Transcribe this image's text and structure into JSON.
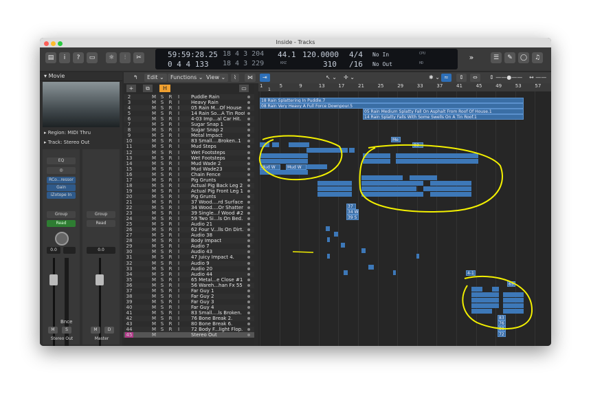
{
  "window": {
    "title": "Inside - Tracks"
  },
  "toolbar": {
    "lcd": {
      "time_top": "59:59:28.25",
      "time_bottom": "0 4 4 133",
      "bars_top": "18 4 3 204",
      "bars_bottom": "18 4 3 229",
      "tempo_label_top": "44.1",
      "tempo_label_bottom": "KHZ",
      "bpm_top": "120.0000",
      "bpm_bottom": "310",
      "sig_top": "4/4",
      "sig_bottom": "/16",
      "in_label": "No In",
      "out_label": "No Out",
      "cpu_label": "CPU",
      "hd_label": "HD"
    }
  },
  "inspector": {
    "header": "Movie",
    "region": "Region: MIDI Thru",
    "track": "Track: Stereo Out",
    "eq": "EQ",
    "plugins": [
      "RCo...ressor",
      "Gain",
      "iZotope In"
    ],
    "group1": "Group",
    "read1": "Read",
    "group2": "Group",
    "read2": "Read",
    "val1": "0.0",
    "val2": "0.0",
    "bnce": "Bnce",
    "m1": "M",
    "s1": "S",
    "m2": "M",
    "d2": "D",
    "strip1": "Stereo Out",
    "strip2": "Master"
  },
  "menubar": {
    "edit": "Edit",
    "functions": "Functions",
    "view": "View"
  },
  "ruler": [
    "1",
    "5",
    "9",
    "13",
    "17",
    "21",
    "25",
    "29",
    "33",
    "37",
    "41",
    "45",
    "49",
    "53",
    "57"
  ],
  "locator": "1",
  "tracks": [
    {
      "n": "2",
      "name": "Puddle Rain"
    },
    {
      "n": "3",
      "name": "Heavy Rain"
    },
    {
      "n": "4",
      "name": "05 Rain M...Of House"
    },
    {
      "n": "5",
      "name": "14 Rain So...A Tin Roof"
    },
    {
      "n": "6",
      "name": "4-03 Imp...al Car Hit."
    },
    {
      "n": "7",
      "name": "Sugar Snap 1"
    },
    {
      "n": "8",
      "name": "Sugar Snap 2"
    },
    {
      "n": "9",
      "name": "Metal Impact"
    },
    {
      "n": "10",
      "name": "83 Small....Broken..1"
    },
    {
      "n": "11",
      "name": "Mud Steps"
    },
    {
      "n": "12",
      "name": "Wet Footsteps"
    },
    {
      "n": "13",
      "name": "Wet Footsteps"
    },
    {
      "n": "14",
      "name": "Mud Wade 2"
    },
    {
      "n": "15",
      "name": "Mud Wade23"
    },
    {
      "n": "16",
      "name": "Chain Fence"
    },
    {
      "n": "17",
      "name": "Pig Grunts"
    },
    {
      "n": "18",
      "name": "Actual Pig Back Leg 2"
    },
    {
      "n": "19",
      "name": "Actual Pig Front Leg 1"
    },
    {
      "n": "20",
      "name": "Pig Grunts"
    },
    {
      "n": "21",
      "name": "37 Wood....rd Surface"
    },
    {
      "n": "22",
      "name": "34 Wood....Or Shatter"
    },
    {
      "n": "23",
      "name": "39 Single...f Wood #2"
    },
    {
      "n": "24",
      "name": "59 Two Si...ls On Bed."
    },
    {
      "n": "25",
      "name": "Audio 21"
    },
    {
      "n": "26",
      "name": "62 Four V...lls On Dirt."
    },
    {
      "n": "27",
      "name": "Audio 38"
    },
    {
      "n": "28",
      "name": "Body Impact"
    },
    {
      "n": "29",
      "name": "Audio 7"
    },
    {
      "n": "30",
      "name": "Audio 43"
    },
    {
      "n": "31",
      "name": "47 Juicy Impact 4."
    },
    {
      "n": "32",
      "name": "Audio 9"
    },
    {
      "n": "33",
      "name": "Audio 20"
    },
    {
      "n": "34",
      "name": "Audio 44"
    },
    {
      "n": "35",
      "name": "65 Metal...e Close #1"
    },
    {
      "n": "36",
      "name": "56 Wareh...han Fx 55"
    },
    {
      "n": "37",
      "name": "Far Guy 1"
    },
    {
      "n": "38",
      "name": "Far Guy 2"
    },
    {
      "n": "39",
      "name": "Far Guy 3"
    },
    {
      "n": "40",
      "name": "Far Guy 4"
    },
    {
      "n": "41",
      "name": "83 Small....ls Broken."
    },
    {
      "n": "42",
      "name": "76 Bone Break 2."
    },
    {
      "n": "43",
      "name": "80 Bone Break 6."
    },
    {
      "n": "44",
      "name": "72 Body F...light Flop."
    },
    {
      "n": "45",
      "name": "Stereo Out"
    }
  ],
  "track_buttons": {
    "m": "M",
    "s": "S",
    "r": "R",
    "i": "I"
  },
  "regions": {
    "r1": "18 Rain Splattering In Puddle.7",
    "r2": "08 Rain Very Heavy A Full Force Downpour.5",
    "r3": "05 Rain Medium Splatty Fall On Asphalt From Roof Of House.1",
    "r4": "14 Rain Splatty Falls With Some Swells On A Tin Roof.1",
    "me": "Me",
    "b83a": "83",
    "mudw1": "Mud W",
    "mudw2": "Mud W",
    "r37": "37",
    "r34": "34 W",
    "r39": "39 S",
    "r41": "4-1",
    "r65": "65",
    "r83b": "83",
    "r76": "76",
    "r80": "80",
    "r72": "72"
  },
  "colors": {
    "accent": "#f0a030",
    "region": "#3a6ea5",
    "highlight": "#f3f000"
  }
}
